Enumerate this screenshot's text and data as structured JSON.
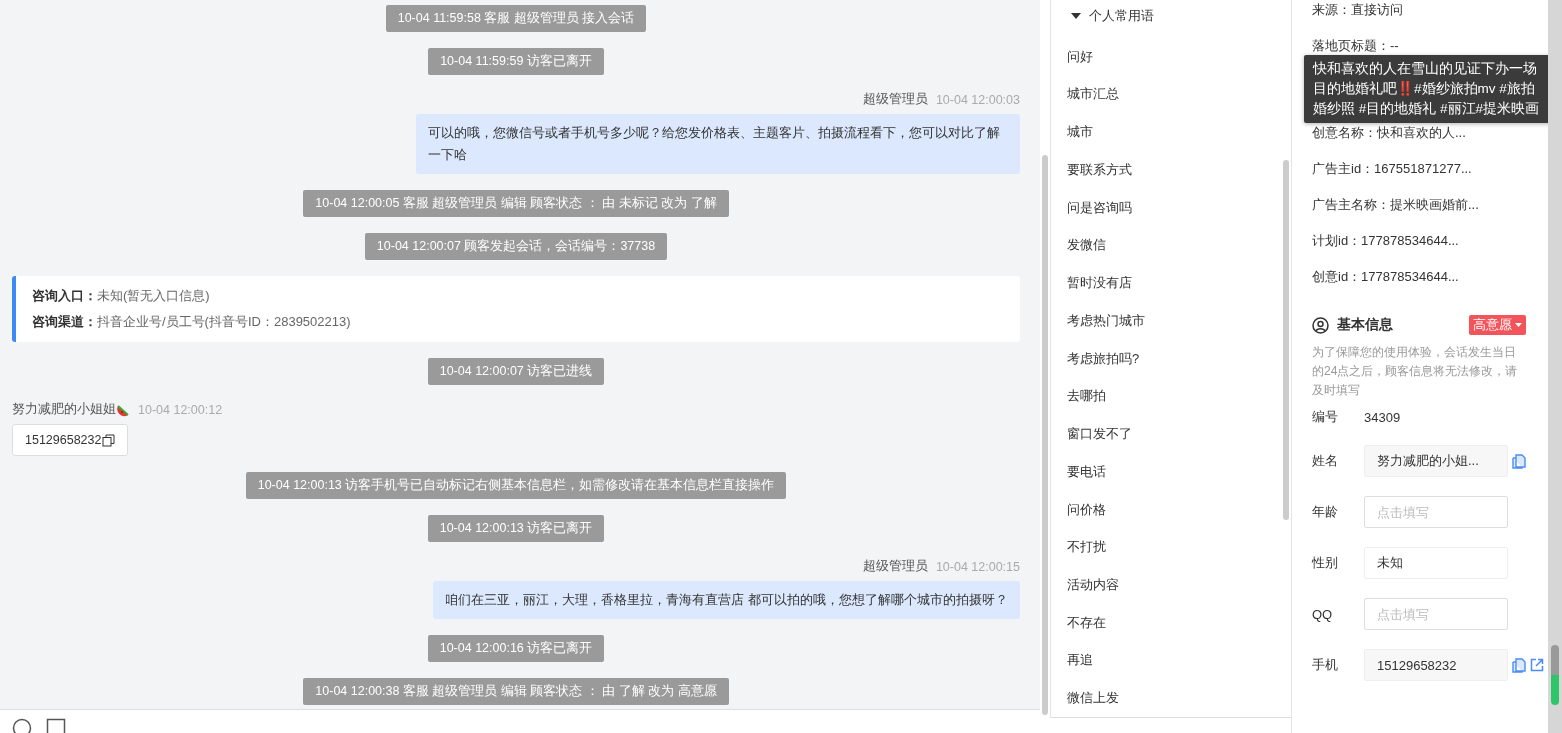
{
  "chat": {
    "messages": [
      {
        "kind": "system",
        "text": "10-04 11:59:58 客服 超级管理员 接入会话"
      },
      {
        "kind": "system",
        "text": "10-04 11:59:59 访客已离开"
      },
      {
        "kind": "agent",
        "sender": "超级管理员",
        "time": "10-04 12:00:03",
        "text": "可以的哦，您微信号或者手机号多少呢？给您发价格表、主题客片、拍摄流程看下，您可以对比了解一下哈"
      },
      {
        "kind": "system",
        "text": "10-04 12:00:05 客服 超级管理员 编辑 顾客状态 ： 由 未标记 改为 了解"
      },
      {
        "kind": "system",
        "text": "10-04 12:00:07 顾客发起会话，会话编号：37738"
      },
      {
        "kind": "info",
        "lines": [
          {
            "label": "咨询入口：",
            "value": "未知(暂无入口信息)"
          },
          {
            "label": "咨询渠道：",
            "value": "抖音企业号/员工号(抖音号ID：2839502213)"
          }
        ]
      },
      {
        "kind": "system",
        "text": "10-04 12:00:07 访客已进线"
      },
      {
        "kind": "visitor",
        "sender": "努力减肥的小姐姐",
        "time": "10-04 12:00:12",
        "text": "15129658232"
      },
      {
        "kind": "system",
        "text": "10-04 12:00:13 访客手机号已自动标记右侧基本信息栏，如需修改请在基本信息栏直接操作"
      },
      {
        "kind": "system",
        "text": "10-04 12:00:13 访客已离开"
      },
      {
        "kind": "agent",
        "sender": "超级管理员",
        "time": "10-04 12:00:15",
        "text": "咱们在三亚，丽江，大理，香格里拉，青海有直营店 都可以拍的哦，您想了解哪个城市的拍摄呀？"
      },
      {
        "kind": "system",
        "text": "10-04 12:00:16 访客已离开"
      },
      {
        "kind": "system",
        "text": "10-04 12:00:38 客服 超级管理员 编辑 顾客状态 ： 由 了解 改为 高意愿"
      }
    ]
  },
  "phrases": {
    "group": "个人常用语",
    "expanded": true,
    "items": [
      "问好",
      "城市汇总",
      "城市",
      "要联系方式",
      "问是咨询吗",
      "发微信",
      "暂时没有店",
      "考虑热门城市",
      "考虑旅拍吗?",
      "去哪拍",
      "窗口发不了",
      "要电话",
      "问价格",
      "不打扰",
      "活动内容",
      "不存在",
      "再追",
      "微信上发"
    ]
  },
  "source": {
    "rows": [
      "来源：直接访问",
      "落地页标题：--"
    ],
    "rows_below": [
      "创意名称：快和喜欢的人...",
      "广告主id：167551871277...",
      "广告主名称：提米映画婚前...",
      "计划id：177878534644...",
      "创意id：177878534644..."
    ],
    "tooltip": "快和喜欢的人在雪山的见证下办一场目的地婚礼吧‼️#婚纱旅拍mv #旅拍婚纱照 #目的地婚礼 #丽江#提米映画"
  },
  "basic_info": {
    "title": "基本信息",
    "intent_tag": "高意愿",
    "notice": "为了保障您的使用体验，会话发生当日的24点之后，顾客信息将无法修改，请及时填写",
    "fields": [
      {
        "label": "编号",
        "kind": "text",
        "value": "34309"
      },
      {
        "label": "姓名",
        "kind": "readonly",
        "value": "努力减肥的小姐...",
        "copy": true,
        "link": false
      },
      {
        "label": "年龄",
        "kind": "input",
        "placeholder": "点击填写"
      },
      {
        "label": "性别",
        "kind": "select",
        "value": "未知"
      },
      {
        "label": "QQ",
        "kind": "input",
        "placeholder": "点击填写"
      },
      {
        "label": "手机",
        "kind": "readonly",
        "value": "15129658232",
        "copy": true,
        "link": true
      }
    ]
  }
}
